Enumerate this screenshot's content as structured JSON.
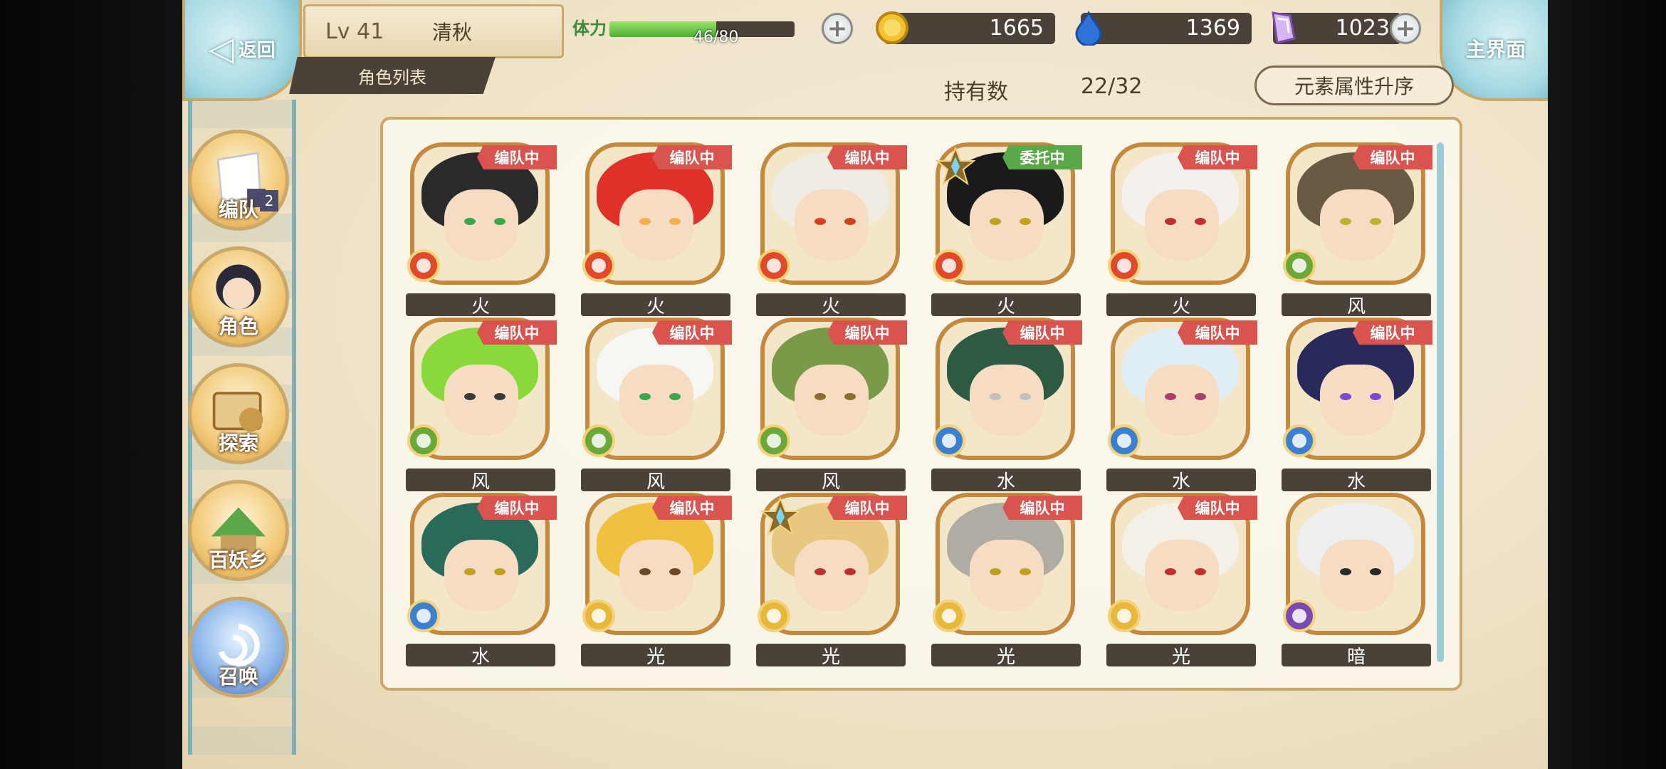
{
  "header": {
    "back_label": "返回",
    "level": "Lv 41",
    "player_name": "清秋",
    "screen_title": "角色列表",
    "stamina_label": "体力",
    "stamina_text": "46/80",
    "stamina_fraction": 0.575,
    "gold": "1665",
    "water": "1369",
    "crystal": "1023",
    "home_label": "主界面"
  },
  "summary": {
    "owned_label": "持有数",
    "owned_value": "22/32",
    "sort_label": "元素属性升序"
  },
  "sidebar": {
    "items": [
      {
        "label": "编队",
        "icon": "formation-icon",
        "badge": "2"
      },
      {
        "label": "角色",
        "icon": "character-icon"
      },
      {
        "label": "探索",
        "icon": "explore-icon"
      },
      {
        "label": "百妖乡",
        "icon": "yokai-village-icon"
      },
      {
        "label": "召唤",
        "icon": "summon-icon"
      }
    ]
  },
  "colors": {
    "fire": "#e04a2a",
    "wind": "#6aa83a",
    "water": "#3a7fd0",
    "light": "#e8b83a",
    "dark": "#7a4ab0",
    "tag_red": "#d9534f",
    "tag_green": "#5aa84a"
  },
  "characters": [
    {
      "element": "火",
      "status": "编队中",
      "status_color": "red",
      "hair": "#2a2a2a",
      "eye": "#3aa84a",
      "elem_color": "#e04a2a",
      "star": false
    },
    {
      "element": "火",
      "status": "编队中",
      "status_color": "red",
      "hair": "#e0302a",
      "eye": "#f0b050",
      "elem_color": "#e04a2a",
      "star": false
    },
    {
      "element": "火",
      "status": "编队中",
      "status_color": "red",
      "hair": "#f0ece4",
      "eye": "#d04020",
      "elem_color": "#e04a2a",
      "star": false
    },
    {
      "element": "火",
      "status": "委托中",
      "status_color": "green",
      "hair": "#1a1a1a",
      "eye": "#c0a020",
      "elem_color": "#e04a2a",
      "star": true
    },
    {
      "element": "火",
      "status": "编队中",
      "status_color": "red",
      "hair": "#f4f0ee",
      "eye": "#c03030",
      "elem_color": "#e04a2a",
      "star": false
    },
    {
      "element": "风",
      "status": "编队中",
      "status_color": "red",
      "hair": "#6a5a44",
      "eye": "#c0b030",
      "elem_color": "#6aa83a",
      "star": false
    },
    {
      "element": "风",
      "status": "编队中",
      "status_color": "red",
      "hair": "#8ad83a",
      "eye": "#3a3a3a",
      "elem_color": "#6aa83a",
      "star": false
    },
    {
      "element": "风",
      "status": "编队中",
      "status_color": "red",
      "hair": "#f6f6f2",
      "eye": "#3aa84a",
      "elem_color": "#6aa83a",
      "star": false
    },
    {
      "element": "风",
      "status": "编队中",
      "status_color": "red",
      "hair": "#7a9a4a",
      "eye": "#8a7030",
      "elem_color": "#6aa83a",
      "star": false
    },
    {
      "element": "水",
      "status": "编队中",
      "status_color": "red",
      "hair": "#2e5a44",
      "eye": "#c0c0c0",
      "elem_color": "#3a7fd0",
      "star": false
    },
    {
      "element": "水",
      "status": "编队中",
      "status_color": "red",
      "hair": "#dfeef4",
      "eye": "#b03a6a",
      "elem_color": "#3a7fd0",
      "star": false
    },
    {
      "element": "水",
      "status": "编队中",
      "status_color": "red",
      "hair": "#2a2a5a",
      "eye": "#7a4ad0",
      "elem_color": "#3a7fd0",
      "star": false
    },
    {
      "element": "水",
      "status": "编队中",
      "status_color": "red",
      "hair": "#2a6a5a",
      "eye": "#c0a020",
      "elem_color": "#3a7fd0",
      "star": false
    },
    {
      "element": "光",
      "status": "编队中",
      "status_color": "red",
      "hair": "#f0c040",
      "eye": "#6a4a2a",
      "elem_color": "#e8b83a",
      "star": false
    },
    {
      "element": "光",
      "status": "编队中",
      "status_color": "red",
      "hair": "#e8c880",
      "eye": "#c03030",
      "elem_color": "#e8b83a",
      "star": true
    },
    {
      "element": "光",
      "status": "编队中",
      "status_color": "red",
      "hair": "#b0aca4",
      "eye": "#c0a020",
      "elem_color": "#e8b83a",
      "star": false
    },
    {
      "element": "光",
      "status": "编队中",
      "status_color": "red",
      "hair": "#f4f0e8",
      "eye": "#c03030",
      "elem_color": "#e8b83a",
      "star": false
    },
    {
      "element": "暗",
      "status": "",
      "status_color": "none",
      "hair": "#eeeeee",
      "eye": "#2a2a2a",
      "elem_color": "#7a4ab0",
      "star": false
    }
  ]
}
